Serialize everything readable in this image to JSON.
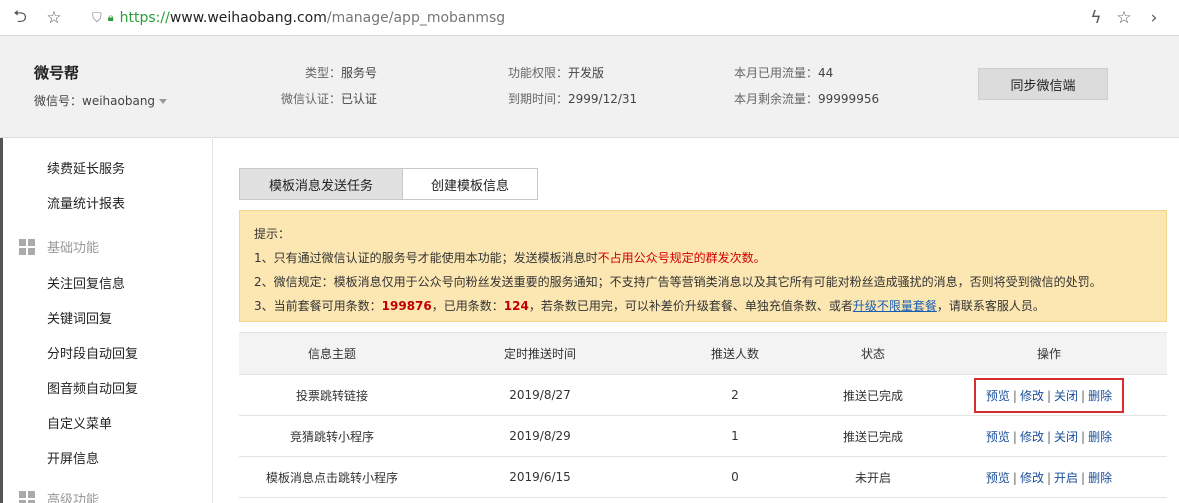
{
  "browser": {
    "url_scheme": "https://",
    "url_host": "www.weihaobang.com",
    "url_path": "/manage/app_mobanmsg"
  },
  "account": {
    "name": "微号帮",
    "wechat_id_label": "微信号：",
    "wechat_id": "weihaobang",
    "type_label": "类型：",
    "type_value": "服务号",
    "verify_label": "微信认证：",
    "verify_value": "已认证",
    "perm_label": "功能权限：",
    "perm_value": "开发版",
    "expire_label": "到期时间：",
    "expire_value": "2999/12/31",
    "used_label": "本月已用流量：",
    "used_value": "44",
    "remain_label": "本月剩余流量：",
    "remain_value": "99999956",
    "sync_button": "同步微信端"
  },
  "sidebar": {
    "items_top": [
      "续费延长服务",
      "流量统计报表"
    ],
    "group_basic": "基础功能",
    "items_basic": [
      "关注回复信息",
      "关键词回复",
      "分时段自动回复",
      "图音频自动回复",
      "自定义菜单",
      "开屏信息"
    ],
    "group_advanced": "高级功能"
  },
  "tabs": [
    {
      "label": "模板消息发送任务"
    },
    {
      "label": "创建模板信息"
    }
  ],
  "notice": {
    "title": "提示：",
    "line1_a": "1、只有通过微信认证的服务号才能使用本功能；发送模板消息时",
    "line1_b": "不占用公众号规定的群发次数。",
    "line2": "2、微信规定：模板消息仅用于公众号向粉丝发送重要的服务通知；不支持广告等营销类消息以及其它所有可能对粉丝造成骚扰的消息，否则将受到微信的处罚。",
    "line3_a": "3、当前套餐可用条数：",
    "line3_available": "199876",
    "line3_b": "，已用条数：",
    "line3_used": "124",
    "line3_c": "，若条数已用完，可以补差价升级套餐、单独充值条数、或者",
    "line3_link": "升级不限量套餐",
    "line3_d": "，请联系客服人员。"
  },
  "table": {
    "headers": [
      "信息主题",
      "定时推送时间",
      "推送人数",
      "状态",
      "操作"
    ],
    "rows": [
      {
        "subject": "投票跳转链接",
        "time": "2019/8/27",
        "count": "2",
        "status": "推送已完成",
        "ops": [
          "预览",
          "修改",
          "关闭",
          "删除"
        ]
      },
      {
        "subject": "竞猜跳转小程序",
        "time": "2019/8/29",
        "count": "1",
        "status": "推送已完成",
        "ops": [
          "预览",
          "修改",
          "关闭",
          "删除"
        ]
      },
      {
        "subject": "模板消息点击跳转小程序",
        "time": "2019/6/15",
        "count": "0",
        "status": "未开启",
        "ops": [
          "预览",
          "修改",
          "开启",
          "删除"
        ]
      }
    ]
  }
}
